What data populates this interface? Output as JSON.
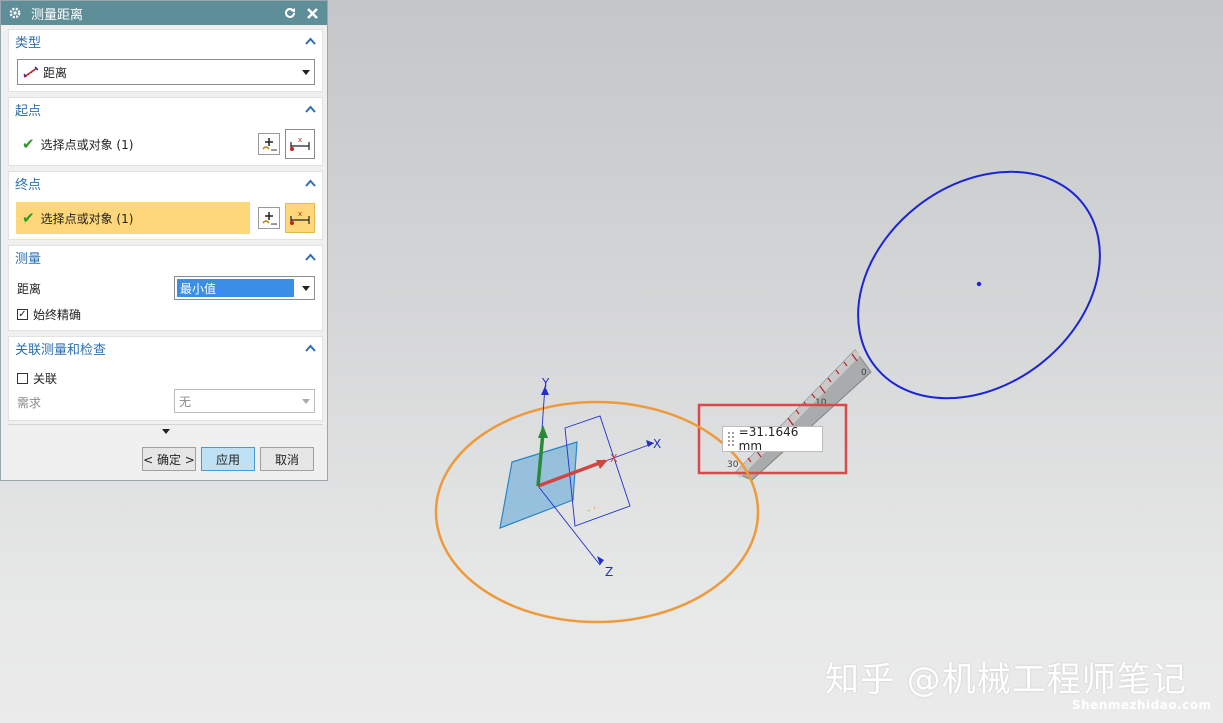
{
  "dialog": {
    "title": "测量距离",
    "type_group": {
      "heading": "类型",
      "selected": "距离"
    },
    "start_group": {
      "heading": "起点",
      "select_label": "选择点或对象 (1)"
    },
    "end_group": {
      "heading": "终点",
      "select_label": "选择点或对象 (1)"
    },
    "measure_group": {
      "heading": "测量",
      "distance_label": "距离",
      "distance_value": "最小值",
      "always_exact_label": "始终精确",
      "always_exact_checked": true
    },
    "assoc_group": {
      "heading": "关联测量和检查",
      "assoc_label": "关联",
      "assoc_checked": false,
      "requirement_label": "需求",
      "requirement_value": "无"
    },
    "buttons": {
      "ok": "< 确定 >",
      "apply": "应用",
      "cancel": "取消"
    }
  },
  "viewport": {
    "measurement": "=31.1646 mm",
    "axis_labels": {
      "x": "X",
      "y": "Y",
      "z": "Z"
    },
    "ruler_ticks": [
      "0",
      "10",
      "30"
    ]
  },
  "watermark": {
    "main": "知乎 @机械工程师笔记",
    "sub": "Shenmezhidao.com"
  },
  "colors": {
    "title_bar": "#5e8e98",
    "group_heading": "#2e6fb0",
    "highlight": "#fdd77a",
    "blue_circle": "#1c25d6",
    "orange_circle": "#ef9a3a",
    "callout_box": "#d9494a"
  }
}
